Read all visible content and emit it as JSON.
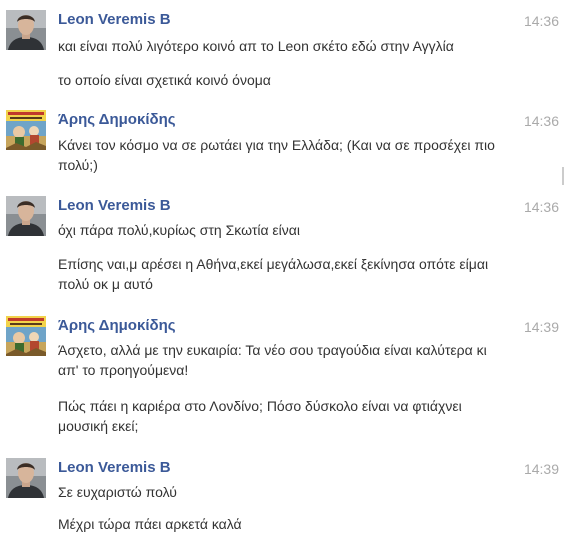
{
  "messages": [
    {
      "sender": "Leon Veremis B",
      "time": "14:36",
      "avatar": "leon-photo",
      "lines": [
        "και είναι πολύ λιγότερο κοινό απ το Leon σκέτο εδώ στην Αγγλία",
        "το οποίο είναι σχετικά κοινό όνομα"
      ]
    },
    {
      "sender": "Άρης Δημοκίδης",
      "time": "14:36",
      "avatar": "aris-comic",
      "lines": [
        "Κάνει τον κόσμο να σε ρωτάει για την Ελλάδα; (Και να σε προσέχει πιο πολύ;)"
      ]
    },
    {
      "sender": "Leon Veremis B",
      "time": "14:36",
      "avatar": "leon-photo",
      "lines": [
        "όχι πάρα πολύ,κυρίως στη Σκωτία είναι",
        "Επίσης ναι,μ αρέσει η Αθήνα,εκεί μεγάλωσα,εκεί ξεκίνησα οπότε είμαι πολύ οκ μ αυτό"
      ]
    },
    {
      "sender": "Άρης Δημοκίδης",
      "time": "14:39",
      "avatar": "aris-comic",
      "lines": [
        "Άσχετο, αλλά με την ευκαιρία: Τα νέο σου τραγούδια είναι καλύτερα κι απ' το προηγούμενα!",
        "Πώς πάει η καριέρα στο Λονδίνο; Πόσο δύσκολο είναι να φτιάχνει μουσική εκεί;"
      ]
    },
    {
      "sender": "Leon Veremis B",
      "time": "14:39",
      "avatar": "leon-photo",
      "lines": [
        "Σε ευχαριστώ πολύ",
        "Μέχρι τώρα πάει αρκετά καλά"
      ]
    }
  ]
}
